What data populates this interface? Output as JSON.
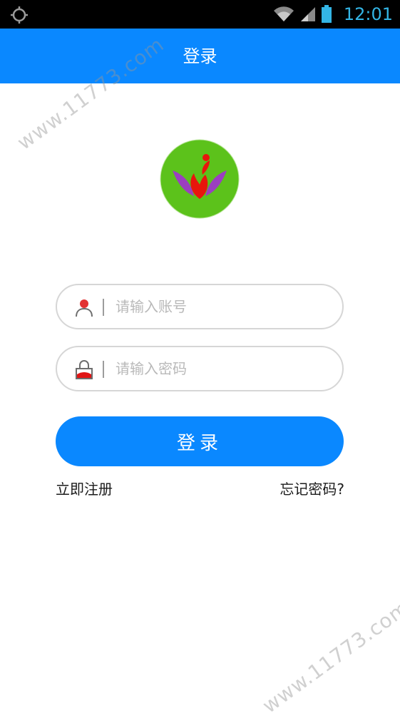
{
  "status_bar": {
    "time": "12:01",
    "icons": [
      "location-icon",
      "wifi-icon",
      "signal-icon",
      "battery-icon"
    ]
  },
  "app_bar": {
    "title": "登录"
  },
  "logo": {
    "icon": "lotus-logo-icon",
    "colors": {
      "background": "#5cc21b",
      "flame": "#e8160c",
      "petals": "#9b3fc0"
    }
  },
  "form": {
    "account": {
      "icon": "user-icon",
      "placeholder": "请输入账号"
    },
    "password": {
      "icon": "lock-icon",
      "placeholder": "请输入密码"
    },
    "submit_label": "登录"
  },
  "links": {
    "register": "立即注册",
    "forgot_password": "忘记密码?"
  },
  "watermark": {
    "text": "www.11773.com"
  },
  "colors": {
    "accent": "#0a88ff",
    "status_text": "#33b5e5"
  }
}
